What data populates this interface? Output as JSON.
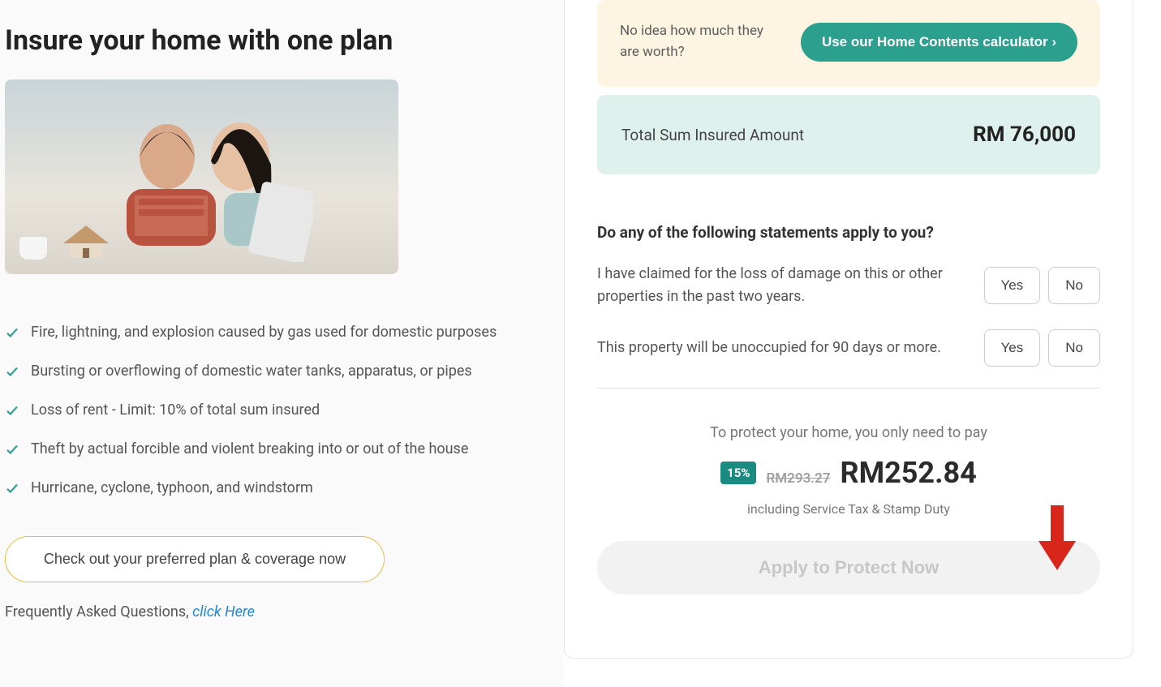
{
  "left": {
    "heading": "Insure your home with one plan",
    "features": [
      "Fire, lightning, and explosion caused by gas used for domestic purposes",
      "Bursting or overflowing of domestic water tanks, apparatus, or pipes",
      "Loss of rent - Limit: 10% of total sum insured",
      "Theft by actual forcible and violent breaking into or out of the house",
      "Hurricane, cyclone, typhoon, and windstorm"
    ],
    "plan_button": "Check out your preferred plan & coverage now",
    "faq_prefix": "Frequently Asked Questions, ",
    "faq_link": "click Here"
  },
  "right": {
    "calc_text": "No idea how much they are worth?",
    "calc_button": "Use our Home Contents calculator ›",
    "total_label": "Total Sum Insured Amount",
    "total_amount": "RM 76,000",
    "questions_heading": "Do any of the following statements apply to you?",
    "questions": [
      "I have claimed for the loss of damage on this or other properties in the past two years.",
      "This property will be unoccupied for 90 days or more."
    ],
    "yes_label": "Yes",
    "no_label": "No",
    "pay_heading": "To protect your home, you only need to pay",
    "discount_badge": "15%",
    "old_price": "RM293.27",
    "new_price": "RM252.84",
    "price_note": "including Service Tax & Stamp Duty",
    "apply_button": "Apply to Protect Now"
  }
}
